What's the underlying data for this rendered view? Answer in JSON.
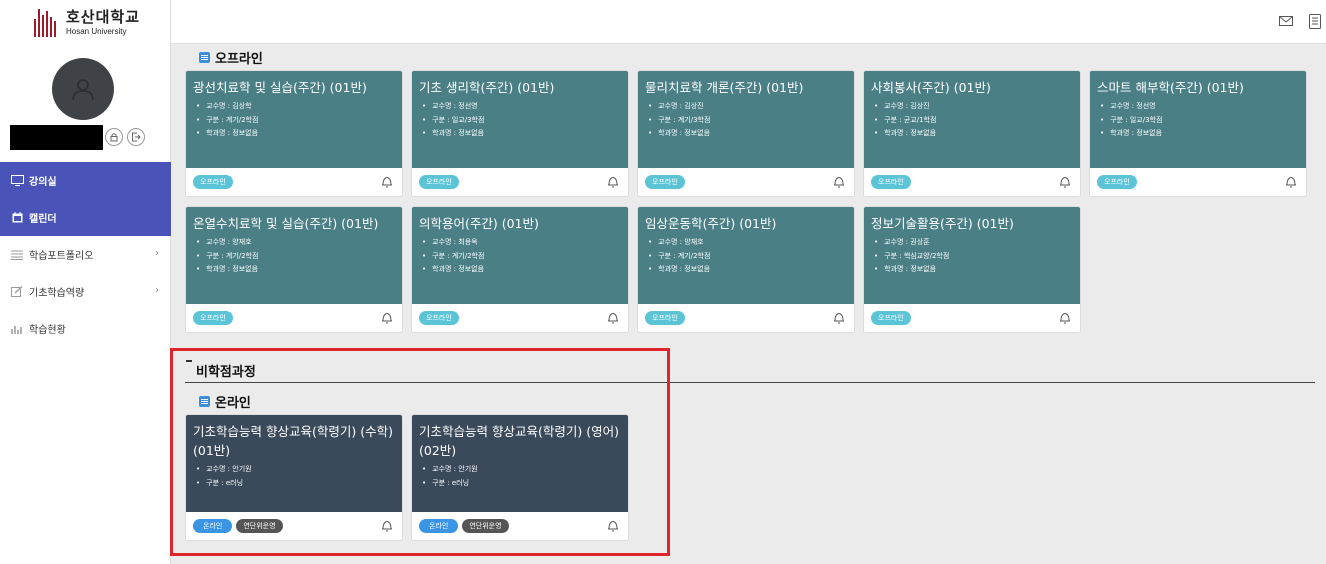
{
  "app": {
    "logo_kr": "호산대학교",
    "logo_en": "Hosan University"
  },
  "sidebar": {
    "items": [
      {
        "label": "강의실",
        "icon": "monitor-icon",
        "active": true
      },
      {
        "label": "캘린더",
        "icon": "calendar-icon",
        "active": true
      },
      {
        "label": "학습포트폴리오",
        "icon": "list-icon",
        "has_chevron": true
      },
      {
        "label": "기초학습역량",
        "icon": "edit-icon",
        "has_chevron": true
      },
      {
        "label": "학습현황",
        "icon": "bar-chart-icon"
      }
    ]
  },
  "topbar": {
    "icons": [
      "mail-icon",
      "document-icon"
    ]
  },
  "offline_section": {
    "title": "오프라인",
    "cards": [
      {
        "title": "광선치료학 및 실습(주간) (01반)",
        "info": [
          "교수명 : 김상학",
          "구분 : 계기/2학점",
          "학과명 : 정보없음"
        ],
        "badge": "오프라인"
      },
      {
        "title": "기초 생리학(주간) (01반)",
        "info": [
          "교수명 : 정선영",
          "구분 : 일교/3학점",
          "학과명 : 정보없음"
        ],
        "badge": "오프라인"
      },
      {
        "title": "물리치료학 개론(주간) (01반)",
        "info": [
          "교수명 : 김상진",
          "구분 : 계기/3학점",
          "학과명 : 정보없음"
        ],
        "badge": "오프라인"
      },
      {
        "title": "사회봉사(주간) (01반)",
        "info": [
          "교수명 : 김상진",
          "구분 : 균교/1학점",
          "학과명 : 정보없음"
        ],
        "badge": "오프라인"
      },
      {
        "title": "스마트 해부학(주간) (01반)",
        "info": [
          "교수명 : 정선영",
          "구분 : 일교/3학점",
          "학과명 : 정보없음"
        ],
        "badge": "오프라인"
      },
      {
        "title": "온열수치료학 및 실습(주간) (01반)",
        "info": [
          "교수명 : 양재호",
          "구분 : 계기/2학점",
          "학과명 : 정보없음"
        ],
        "badge": "오프라인"
      },
      {
        "title": "의학용어(주간) (01반)",
        "info": [
          "교수명 : 최용옥",
          "구분 : 계기/2학점",
          "학과명 : 정보없음"
        ],
        "badge": "오프라인"
      },
      {
        "title": "임상운동학(주간) (01반)",
        "info": [
          "교수명 : 양재호",
          "구분 : 계기/2학점",
          "학과명 : 정보없음"
        ],
        "badge": "오프라인"
      },
      {
        "title": "정보기술활용(주간) (01반)",
        "info": [
          "교수명 : 권상훈",
          "구분 : 핵심교양/2학점",
          "학과명 : 정보없음"
        ],
        "badge": "오프라인"
      }
    ]
  },
  "noncredit_section": {
    "title": "비학점과정",
    "sub_title": "온라인",
    "cards": [
      {
        "title": "기초학습능력 향상교육(학령기) (수학) (01반)",
        "info": [
          "교수명 : 안기원",
          "구분 : e러닝"
        ],
        "badges": [
          "온라인",
          "연단위운영"
        ]
      },
      {
        "title": "기초학습능력 향상교육(학령기) (영어) (02반)",
        "info": [
          "교수명 : 안기원",
          "구분 : e러닝"
        ],
        "badges": [
          "온라인",
          "연단위운영"
        ]
      }
    ]
  },
  "colors": {
    "offline_card": "#4a7f86",
    "online_card": "#3a4a5a",
    "sidebar_active": "#4a54b8",
    "highlight": "#e0242a"
  }
}
